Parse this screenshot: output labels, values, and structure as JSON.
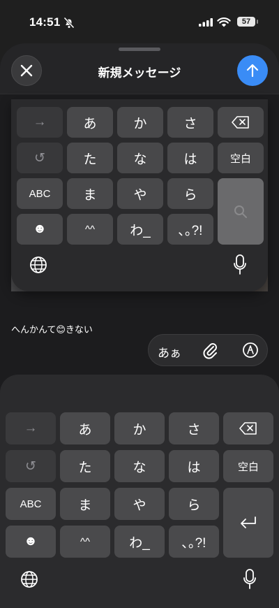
{
  "status": {
    "time": "14:51",
    "battery": "57"
  },
  "header": {
    "title": "新規メッセージ"
  },
  "message": {
    "text": "へんかんて😊きない"
  },
  "input_pill": {
    "mode_label": "あぁ"
  },
  "keyboard": {
    "row1": [
      "→",
      "あ",
      "か",
      "さ"
    ],
    "row2": [
      "↺",
      "た",
      "な",
      "は",
      "空白"
    ],
    "row3": [
      "ABC",
      "ま",
      "や",
      "ら"
    ],
    "row4": [
      "☻",
      "^^",
      "わ_",
      "､｡?!"
    ]
  },
  "colors": {
    "accent": "#3a8cf6",
    "key": "#48484a",
    "background": "#1c1c1e"
  }
}
